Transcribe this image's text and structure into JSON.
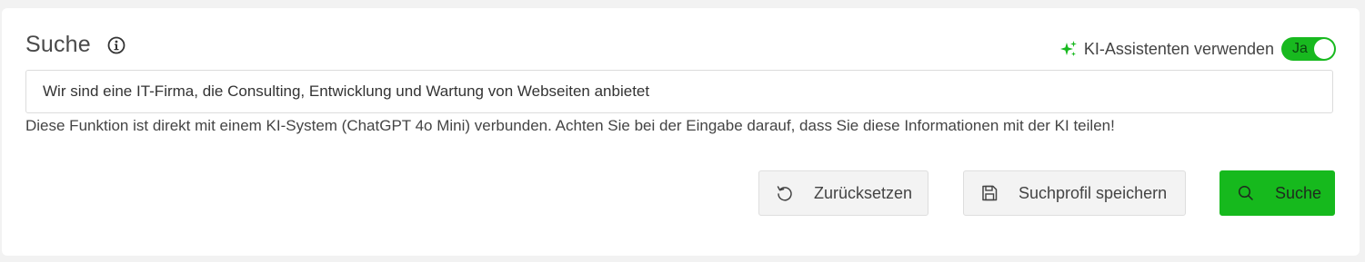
{
  "search": {
    "title": "Suche",
    "info_icon": "info-icon",
    "ai": {
      "icon": "sparkle-icon",
      "label": "KI-Assistenten verwenden",
      "toggle_label": "Ja",
      "enabled": true,
      "color": "#18b91f"
    },
    "input_value": "Wir sind eine IT-Firma, die Consulting, Entwicklung und Wartung von Webseiten anbietet",
    "hint": "Diese Funktion ist direkt mit einem KI-System (ChatGPT 4o Mini) verbunden. Achten Sie bei der Eingabe darauf, dass Sie diese Informationen mit der KI teilen!"
  },
  "actions": {
    "reset": {
      "label": "Zurücksetzen",
      "icon": "reset-icon"
    },
    "save_profile": {
      "label": "Suchprofil speichern",
      "icon": "save-icon"
    },
    "search": {
      "label": "Suche",
      "icon": "search-icon",
      "color": "#16b91d"
    }
  }
}
